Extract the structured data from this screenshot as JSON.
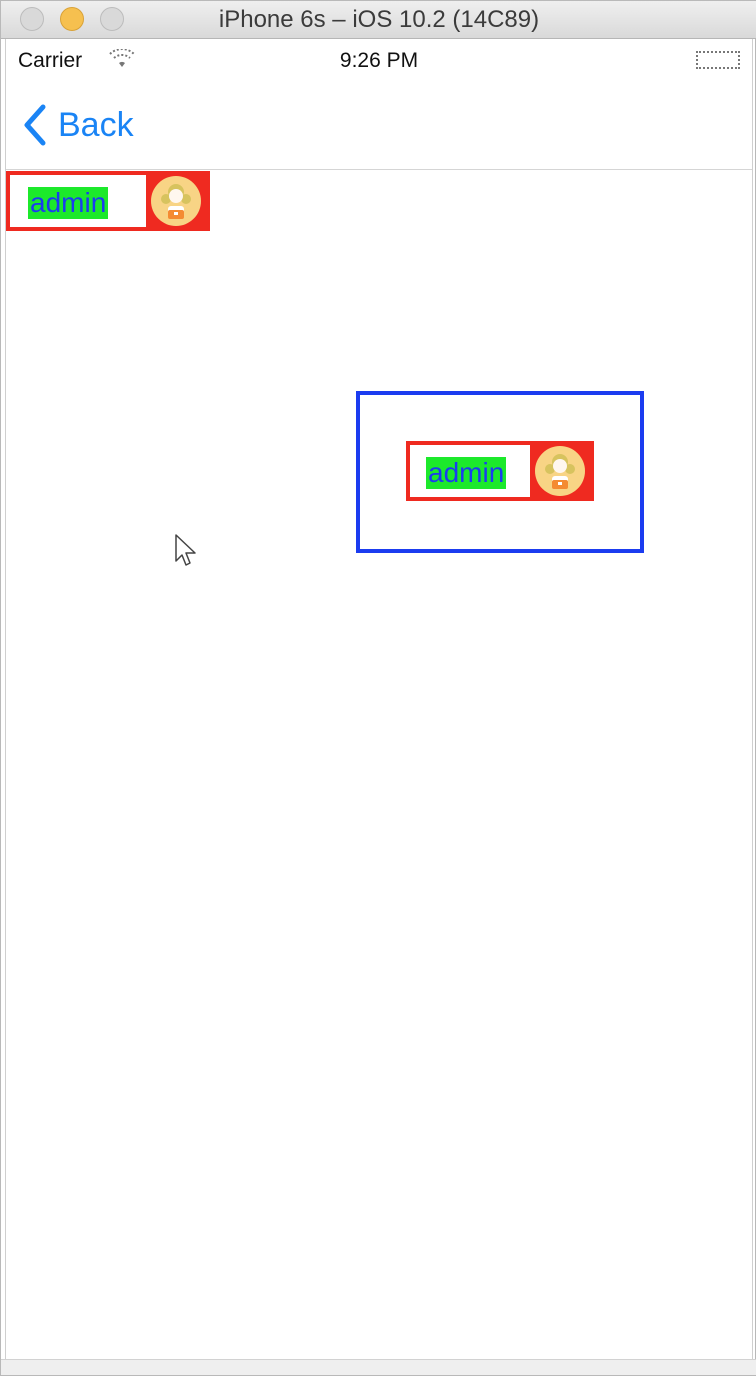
{
  "window": {
    "title": "iPhone 6s – iOS 10.2 (14C89)"
  },
  "status_bar": {
    "carrier": "Carrier",
    "time": "9:26 PM"
  },
  "navigation": {
    "back_label": "Back"
  },
  "content": {
    "chip_one_label": "admin",
    "chip_two_label": "admin"
  },
  "colors": {
    "back": "#1a84f5",
    "label_background": "#1ce92b",
    "label_text": "#1b3cf0",
    "chip_border": "#ef2a20",
    "container_border": "#1b3cf0"
  },
  "icons": {
    "back": "chevron-left-icon",
    "wifi": "wifi-icon",
    "avatar": "girl-avatar-icon",
    "battery": "battery-icon"
  }
}
